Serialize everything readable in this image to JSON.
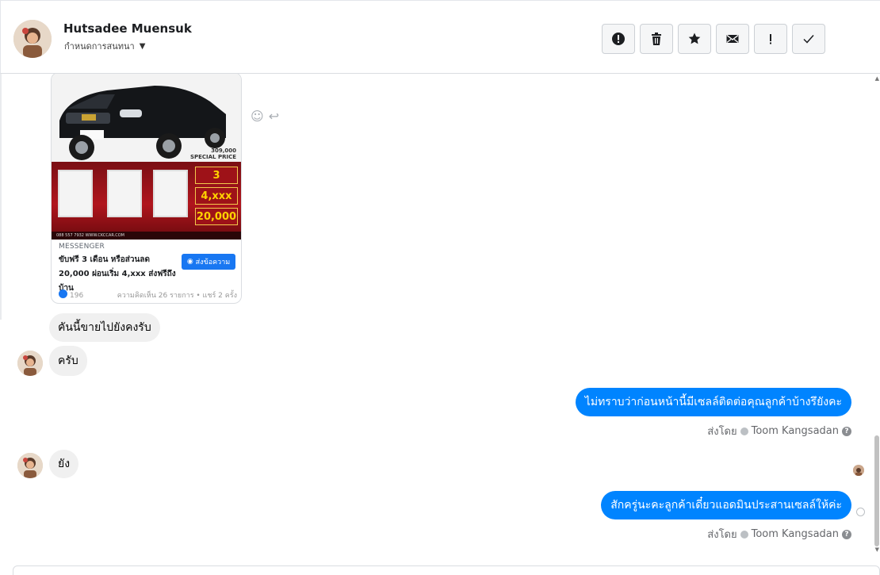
{
  "header": {
    "contact_name": "Hutsadee Muensuk",
    "subtitle": "กำหนดการสนทนา",
    "actions": [
      {
        "name": "alert-icon"
      },
      {
        "name": "trash-icon"
      },
      {
        "name": "star-icon"
      },
      {
        "name": "mail-icon"
      },
      {
        "name": "exclamation-icon"
      },
      {
        "name": "check-icon"
      }
    ]
  },
  "ad_card": {
    "price_line": "309,000",
    "price_sub": "SPECIAL PRICE",
    "tag_1": "3",
    "tag_2": "4,xxx",
    "tag_3": "20,000",
    "footer_text": "088 557 7932 WWW.CKCCAR.COM",
    "caption": "MESSENGER",
    "text": "ขับฟรี 3 เดือน หรือส่วนลด 20,000 ผ่อนเริ่ม 4,xxx ส่งฟรีถึงบ้าน",
    "cta": "ส่งข้อความ",
    "likes": "196",
    "comments": "ความคิดเห็น 26 รายการ • แชร์ 2 ครั้ง"
  },
  "messages": [
    {
      "id": "m1",
      "direction": "in",
      "text": "คันนี้ขายไปยังคงรับ"
    },
    {
      "id": "m2",
      "direction": "in",
      "text": "ครับ"
    },
    {
      "id": "m3",
      "direction": "out",
      "text": "ไม่ทราบว่าก่อนหน้านี้มีเซลล์ติดต่อคุณลูกค้าบ้างรึยังคะ"
    },
    {
      "id": "m4",
      "direction": "in",
      "text": "ยัง"
    },
    {
      "id": "m5",
      "direction": "out",
      "text": "สักครู่นะคะลูกค้าเดี๋ยวแอดมินประสานเซลล์ให้ค่ะ"
    }
  ],
  "sent_by": {
    "prefix": "ส่งโดย",
    "agent": "Toom Kangsadan",
    "help": "?"
  },
  "colors": {
    "outgoing_bubble": "#0084ff",
    "incoming_bubble": "#f0f0f0",
    "cta": "#1877f2"
  }
}
